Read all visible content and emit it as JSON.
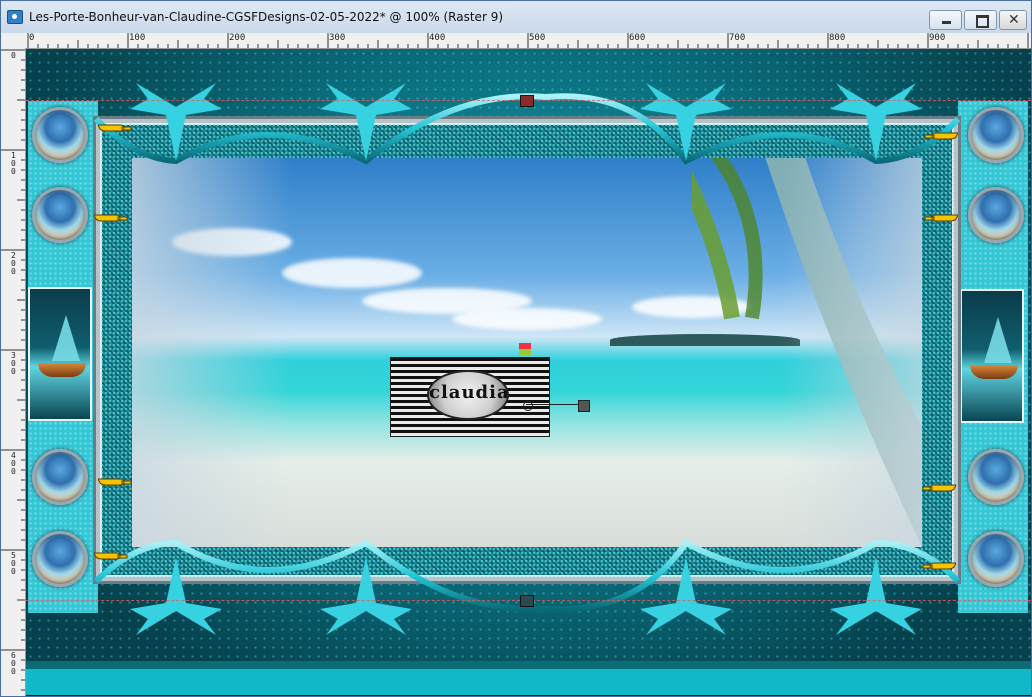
{
  "window": {
    "title": "Les-Porte-Bonheur-van-Claudine-CGSFDesigns-02-05-2022* @ 100% (Raster 9)",
    "app_icon": "image-icon",
    "controls": {
      "minimize": "minimize-icon",
      "maximize": "maximize-icon",
      "close": "close-icon",
      "close_glyph": "✕"
    }
  },
  "ruler": {
    "top_ticks": [
      "0",
      "100",
      "200",
      "300",
      "400",
      "500",
      "600",
      "700",
      "800",
      "900"
    ],
    "left_ticks": [
      "0",
      "100",
      "200",
      "300",
      "400",
      "500",
      "600"
    ]
  },
  "canvas": {
    "logo_text": "claudia",
    "colors": {
      "teal_dark": "#06414d",
      "teal": "#1aa6b6",
      "teal_light": "#34c7d6",
      "frame": "#b8c3c8",
      "band": "#10b8c8"
    }
  }
}
